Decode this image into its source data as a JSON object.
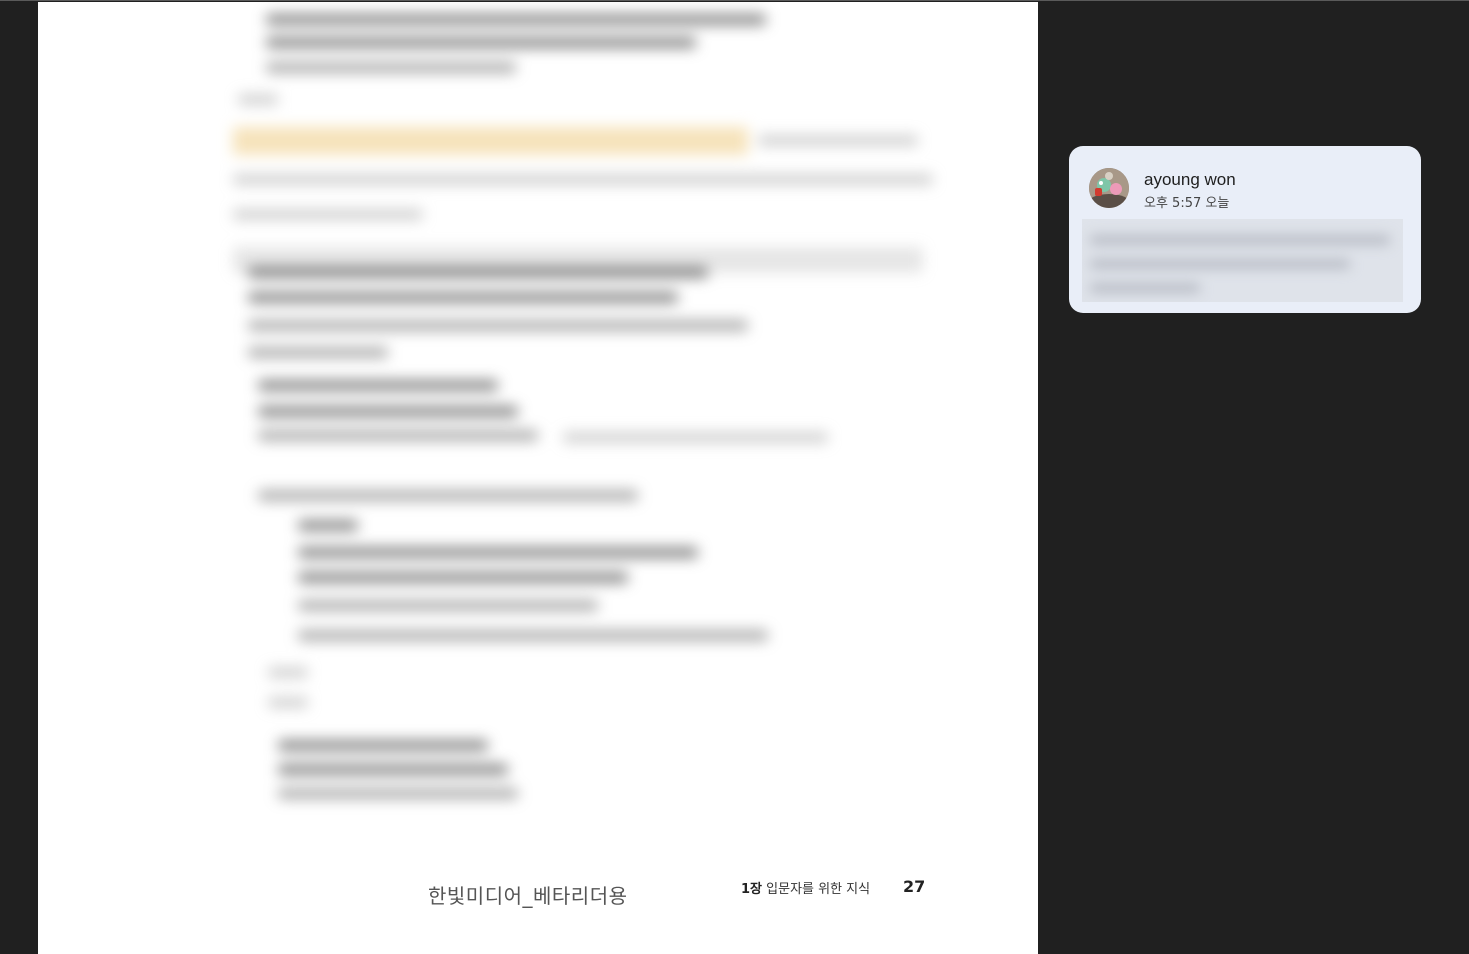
{
  "document": {
    "watermark": "한빛미디어_베타리더용",
    "chapter_number": "1장",
    "chapter_title": "입문자를 위한 지식",
    "page_number": "27"
  },
  "comment": {
    "author": "ayoung won",
    "timestamp": "오후 5:57 오늘",
    "avatar_icon": "avatar-photo-icon"
  },
  "colors": {
    "background": "#202020",
    "page": "#ffffff",
    "comment_card": "#e9eef8",
    "highlight": "#f4dcaa"
  }
}
